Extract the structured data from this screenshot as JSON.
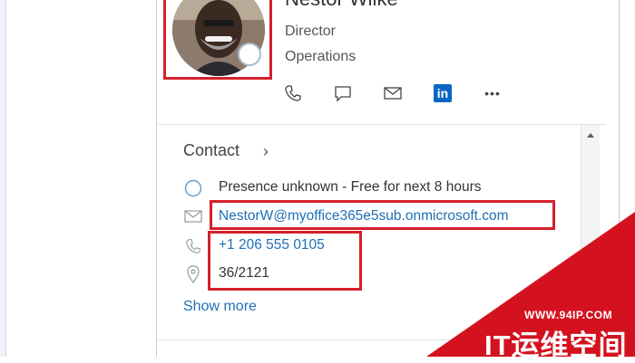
{
  "profile": {
    "name": "Nestor Wilke",
    "job_title": "Director",
    "department": "Operations",
    "actions": [
      "phone-icon",
      "chat-icon",
      "mail-icon",
      "linkedin-icon",
      "more-icon"
    ],
    "linkedin_label": "in",
    "more_label": "•••"
  },
  "contact": {
    "header": "Contact",
    "chevron": "›",
    "presence": "Presence unknown - Free for next 8 hours",
    "email": "NestorW@myoffice365e5sub.onmicrosoft.com",
    "phone": "+1 206 555 0105",
    "office": "36/2121",
    "show_more": "Show more"
  },
  "watermark": {
    "url": "WWW.94IP.COM",
    "brand": "IT运维空间"
  },
  "colors": {
    "accent": "#1f6fb4",
    "highlight": "#d4202b",
    "linkedin": "#0a66c2"
  }
}
